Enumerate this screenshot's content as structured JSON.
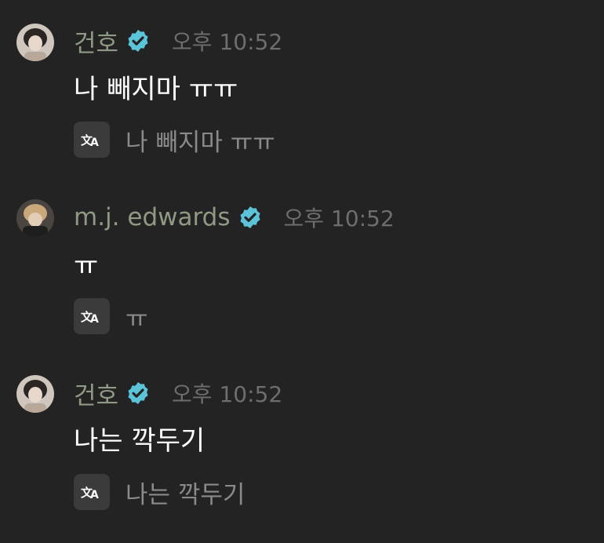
{
  "colors": {
    "background": "#232323",
    "author": "#8f9a84",
    "timestamp": "#6e6e6e",
    "message_text": "#ffffff",
    "translation_text": "#8a8a8a",
    "verified_badge": "#5cc4d9",
    "translate_button": "#3b3b3b"
  },
  "messages": [
    {
      "author": "건호",
      "verified": true,
      "avatar_icon": "user-avatar",
      "timestamp": "오후 10:52",
      "text": "나 빼지마 ㅠㅠ",
      "translate_icon": "translate-icon",
      "translation": "나 빼지마 ㅠㅠ"
    },
    {
      "author": "m.j. edwards",
      "verified": true,
      "avatar_icon": "user-avatar",
      "timestamp": "오후 10:52",
      "text": "ㅠ",
      "translate_icon": "translate-icon",
      "translation": "ㅠ"
    },
    {
      "author": "건호",
      "verified": true,
      "avatar_icon": "user-avatar",
      "timestamp": "오후 10:52",
      "text": "나는 깍두기",
      "translate_icon": "translate-icon",
      "translation": "나는 깍두기"
    }
  ]
}
